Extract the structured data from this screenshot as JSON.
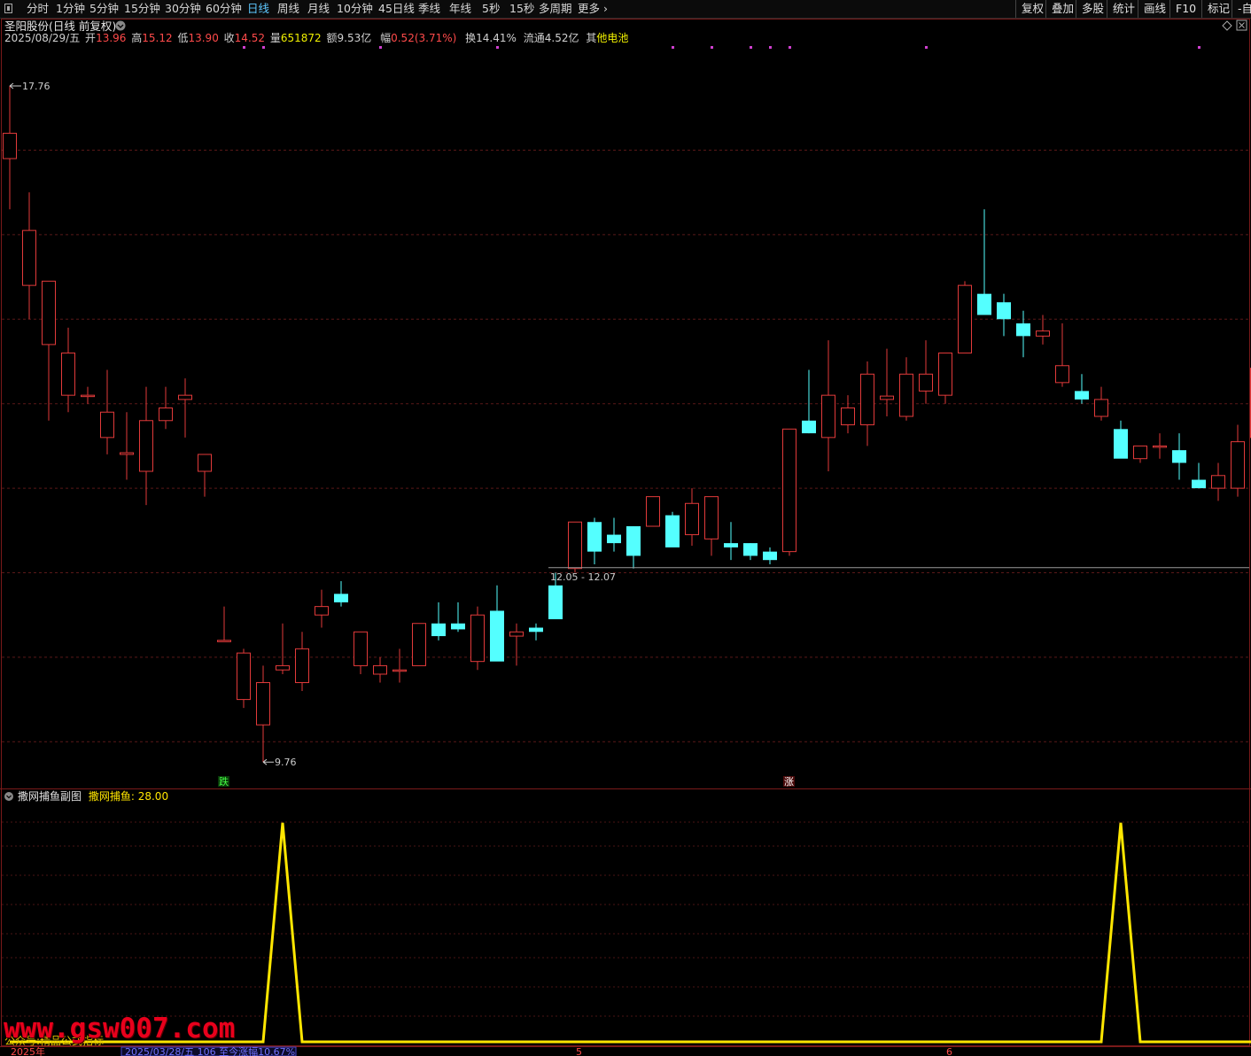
{
  "toolbar": {
    "periods": [
      "分时",
      "1分钟",
      "5分钟",
      "15分钟",
      "30分钟",
      "60分钟",
      "日线",
      "周线",
      "月线",
      "10分钟",
      "45日线",
      "季线",
      "年线",
      "5秒",
      "15秒",
      "多周期",
      "更多 ›"
    ],
    "active": "日线",
    "right_tools": [
      "复权",
      "叠加",
      "多股",
      "统计",
      "画线",
      "F10",
      "标记",
      "-自"
    ]
  },
  "header": {
    "title": "圣阳股份(日线 前复权)",
    "date": "2025/08/29/五",
    "open_label": "开",
    "open": "13.96",
    "high_label": "高",
    "high": "15.12",
    "low_label": "低",
    "low": "13.90",
    "close_label": "收",
    "close": "14.52",
    "volume_label": "量",
    "volume": "651872",
    "amount_label": "额",
    "amount": "9.53亿",
    "change_label": "幅",
    "change": "0.52(3.71%)",
    "turnover_label": "换",
    "turnover": "14.41%",
    "float_label": "流通",
    "float": "4.52亿",
    "sector_prefix": "其",
    "sector": "他电池"
  },
  "main_chart": {
    "type": "candlestick",
    "ylim": [
      9.5,
      18.2
    ],
    "max_label": "17.76",
    "min_label": "9.76",
    "range_label": "12.05 - 12.07",
    "hline": 12.06,
    "signal_down": "跌",
    "signal_up": "涨",
    "candles": [
      [
        16.9,
        17.76,
        16.3,
        17.2
      ],
      [
        15.4,
        16.5,
        15.0,
        16.05
      ],
      [
        14.7,
        15.2,
        13.8,
        15.45
      ],
      [
        14.1,
        14.9,
        13.9,
        14.6
      ],
      [
        14.1,
        14.2,
        14.0,
        14.1
      ],
      [
        13.6,
        14.4,
        13.4,
        13.9
      ],
      [
        13.4,
        13.9,
        13.1,
        13.42
      ],
      [
        13.2,
        14.2,
        12.8,
        13.8
      ],
      [
        13.8,
        14.2,
        13.7,
        13.95
      ],
      [
        14.05,
        14.3,
        13.6,
        14.1
      ],
      [
        13.2,
        13.4,
        12.9,
        13.4
      ],
      [
        11.2,
        11.6,
        11.2,
        11.2
      ],
      [
        10.5,
        11.1,
        10.4,
        11.05
      ],
      [
        10.2,
        10.9,
        9.76,
        10.7
      ],
      [
        10.85,
        11.4,
        10.8,
        10.9
      ],
      [
        10.7,
        11.3,
        10.6,
        11.1
      ],
      [
        11.5,
        11.8,
        11.35,
        11.6
      ],
      [
        11.75,
        11.9,
        11.6,
        11.65
      ],
      [
        10.9,
        11.3,
        10.8,
        11.3
      ],
      [
        10.8,
        11.0,
        10.7,
        10.9
      ],
      [
        10.85,
        11.1,
        10.7,
        10.85
      ],
      [
        10.9,
        11.4,
        10.9,
        11.4
      ],
      [
        11.4,
        11.65,
        11.2,
        11.25
      ],
      [
        11.4,
        11.65,
        11.3,
        11.33
      ],
      [
        10.95,
        11.6,
        10.85,
        11.5
      ],
      [
        11.55,
        11.85,
        11.55,
        10.95
      ],
      [
        11.25,
        11.4,
        10.9,
        11.3
      ],
      [
        11.35,
        11.4,
        11.2,
        11.3
      ],
      [
        11.85,
        12.0,
        11.68,
        11.45
      ],
      [
        12.05,
        12.4,
        12.0,
        12.6
      ],
      [
        12.6,
        12.65,
        12.1,
        12.25
      ],
      [
        12.45,
        12.65,
        12.25,
        12.35
      ],
      [
        12.55,
        12.55,
        12.05,
        12.2
      ],
      [
        12.55,
        12.9,
        12.55,
        12.9
      ],
      [
        12.68,
        12.72,
        12.6,
        12.3
      ],
      [
        12.45,
        13.0,
        12.32,
        12.82
      ],
      [
        12.4,
        12.9,
        12.2,
        12.9
      ],
      [
        12.35,
        12.6,
        12.15,
        12.3
      ],
      [
        12.35,
        12.35,
        12.15,
        12.2
      ],
      [
        12.25,
        12.3,
        12.1,
        12.15
      ],
      [
        12.25,
        13.7,
        12.2,
        13.7
      ],
      [
        13.8,
        14.4,
        13.65,
        13.65
      ],
      [
        13.6,
        14.75,
        13.2,
        14.1
      ],
      [
        13.75,
        14.1,
        13.65,
        13.95
      ],
      [
        13.75,
        14.5,
        13.5,
        14.35
      ],
      [
        14.05,
        14.65,
        13.85,
        14.09
      ],
      [
        13.85,
        14.55,
        13.8,
        14.35
      ],
      [
        14.15,
        14.75,
        14.0,
        14.35
      ],
      [
        14.1,
        14.6,
        14.0,
        14.6
      ],
      [
        14.6,
        15.45,
        14.6,
        15.4
      ],
      [
        15.3,
        16.3,
        15.2,
        15.05
      ],
      [
        15.2,
        15.3,
        14.8,
        15.0
      ],
      [
        14.95,
        15.1,
        14.55,
        14.8
      ],
      [
        14.8,
        15.05,
        14.7,
        14.86
      ],
      [
        14.25,
        14.95,
        14.2,
        14.45
      ],
      [
        14.15,
        14.35,
        14.0,
        14.05
      ],
      [
        13.85,
        14.2,
        13.8,
        14.05
      ],
      [
        13.7,
        13.8,
        13.45,
        13.35
      ],
      [
        13.35,
        13.5,
        13.3,
        13.5
      ],
      [
        13.5,
        13.65,
        13.35,
        13.5
      ],
      [
        13.45,
        13.65,
        13.1,
        13.3
      ],
      [
        13.1,
        13.3,
        13.0,
        13.0
      ],
      [
        13.0,
        13.3,
        12.85,
        13.15
      ],
      [
        13.0,
        13.75,
        12.9,
        13.55
      ],
      [
        13.6,
        14.2,
        13.55,
        14.42
      ]
    ]
  },
  "sub_chart": {
    "title": "撒网捕鱼副图",
    "indicator_name": "撒网捕鱼",
    "indicator_value": "28.00",
    "ylim": [
      0,
      30
    ],
    "peaks": [
      [
        14,
        28.0
      ],
      [
        57,
        28.0
      ]
    ]
  },
  "bottom_axis": {
    "left_label": "2025年",
    "range_info": "2025/03/28/五 106 至今涨幅10.67%",
    "month_a": "5",
    "month_b": "6"
  },
  "watermark": {
    "text": "www.gsw007.com",
    "sub": "公众号:精品公式指标"
  },
  "colors": {
    "up": "#e23a3a",
    "down": "#54ffff",
    "indicator": "#ffe600",
    "grid": "#5a1818",
    "active_tab": "#5ec8ff"
  }
}
